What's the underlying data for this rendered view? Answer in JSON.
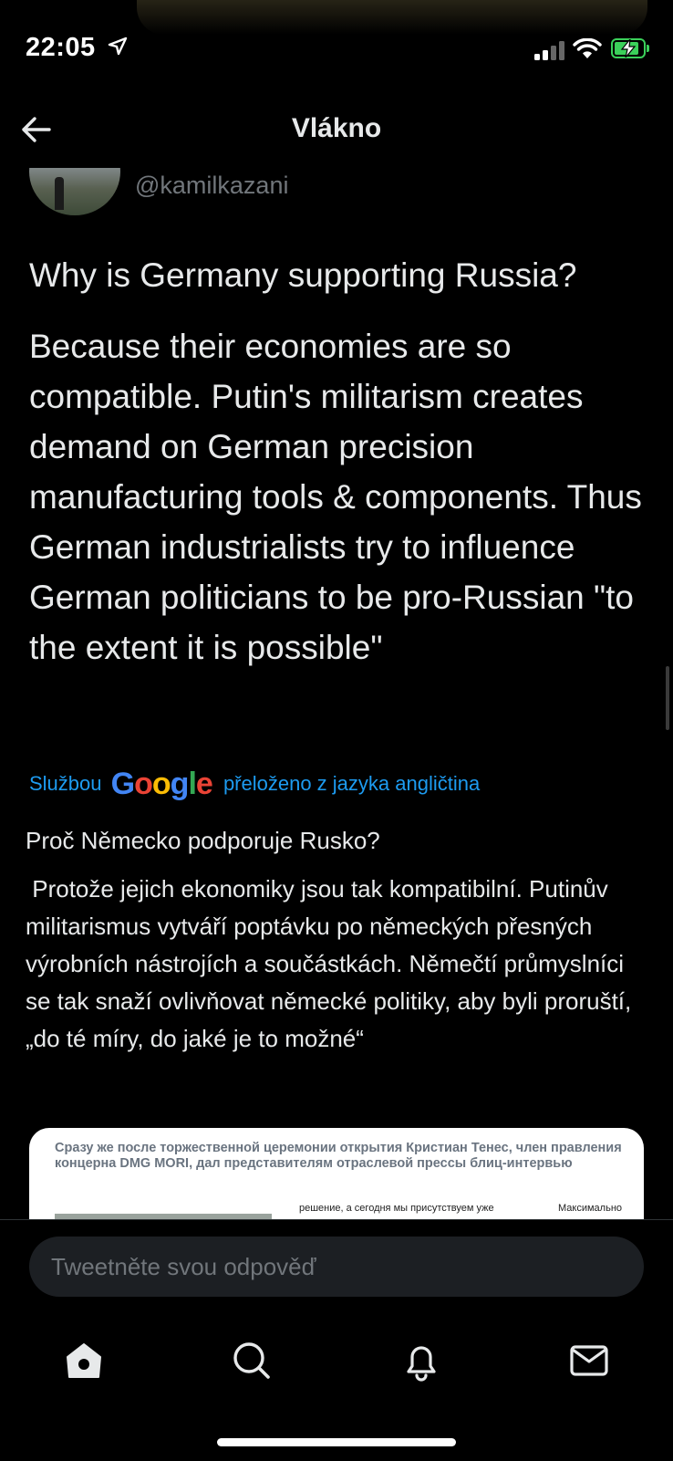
{
  "status_bar": {
    "time": "22:05",
    "icons": [
      "location-arrow-icon",
      "cellular-signal-icon",
      "wifi-icon",
      "battery-charging-icon"
    ],
    "battery_color": "#3bd05a"
  },
  "header": {
    "title": "Vlákno",
    "back_icon": "back-arrow-icon"
  },
  "tweet": {
    "handle": "@kamilkazani",
    "question": "Why is Germany supporting Russia?",
    "body": "Because their economies are so compatible. Putin's militarism creates demand on German precision manufacturing tools & components. Thus German industrialists try to influence German politicians to be pro-Russian \"to the extent it is possible\""
  },
  "translation": {
    "prefix": "Službou",
    "logo_text": "Google",
    "suffix": "přeloženo z jazyka angličtina",
    "question": "Proč Německo podporuje Rusko?",
    "body": " Protože jejich ekonomiky jsou tak kompatibilní. Putinův militarismus vytváří poptávku po německých přesných výrobních nástrojích a součástkách. Němečtí průmyslníci se tak snaží ovlivňovat německé politiky, aby byli proruští, „do té míry, do jaké je to možné“"
  },
  "media": {
    "headline": "Сразу же после торжественной церемонии открытия Кристиан Тенес, член правления концерна DMG MORI, дал представителям отраслевой прессы блиц-интервью",
    "col1": "решение, а сегодня мы присутствуем уже",
    "col2": "Максимально"
  },
  "reply": {
    "placeholder": "Tweetněte svou odpověď"
  },
  "tabbar": {
    "items": [
      "home-icon",
      "search-icon",
      "notifications-icon",
      "messages-icon"
    ]
  },
  "colors": {
    "background": "#000000",
    "text": "#e7e9ea",
    "muted": "#71767b",
    "accent": "#1d9bf0"
  }
}
